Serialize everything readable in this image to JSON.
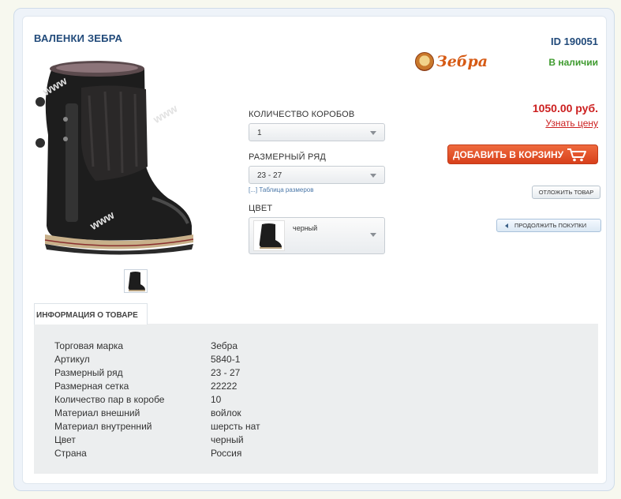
{
  "product": {
    "title": "ВАЛЕНКИ ЗЕБРА",
    "id_label": "ID 190051",
    "brand": "Зебра",
    "stock": "В наличии",
    "price": "1050.00 руб.",
    "ask_price": "Узнать цену"
  },
  "options": {
    "boxes_label": "КОЛИЧЕСТВО КОРОБОВ",
    "boxes_value": "1",
    "size_label": "РАЗМЕРНЫЙ РЯД",
    "size_value": "23 - 27",
    "size_table_link": "[...] Таблица размеров",
    "color_label": "ЦВЕТ",
    "color_value": "черный"
  },
  "actions": {
    "add_to_cart": "ДОБАВИТЬ В КОРЗИНУ",
    "defer": "ОТЛОЖИТЬ ТОВАР",
    "continue": "ПРОДОЛЖИТЬ ПОКУПКИ"
  },
  "info": {
    "tab": "ИНФОРМАЦИЯ О ТОВАРЕ",
    "specs": [
      {
        "key": "Торговая марка",
        "value": "Зебра"
      },
      {
        "key": "Артикул",
        "value": "5840-1"
      },
      {
        "key": "Размерный ряд",
        "value": "23 - 27"
      },
      {
        "key": "Размерная сетка",
        "value": "22222"
      },
      {
        "key": "Количество пар в коробе",
        "value": "10"
      },
      {
        "key": "Материал внешний",
        "value": "войлок"
      },
      {
        "key": "Материал внутренний",
        "value": "шерсть нат"
      },
      {
        "key": "Цвет",
        "value": "черный"
      },
      {
        "key": "Страна",
        "value": "Россия"
      }
    ]
  },
  "colors": {
    "price": "#cc1f1f",
    "stock": "#3f9b2f",
    "title": "#214a7a",
    "cart_button": "#e05228"
  }
}
